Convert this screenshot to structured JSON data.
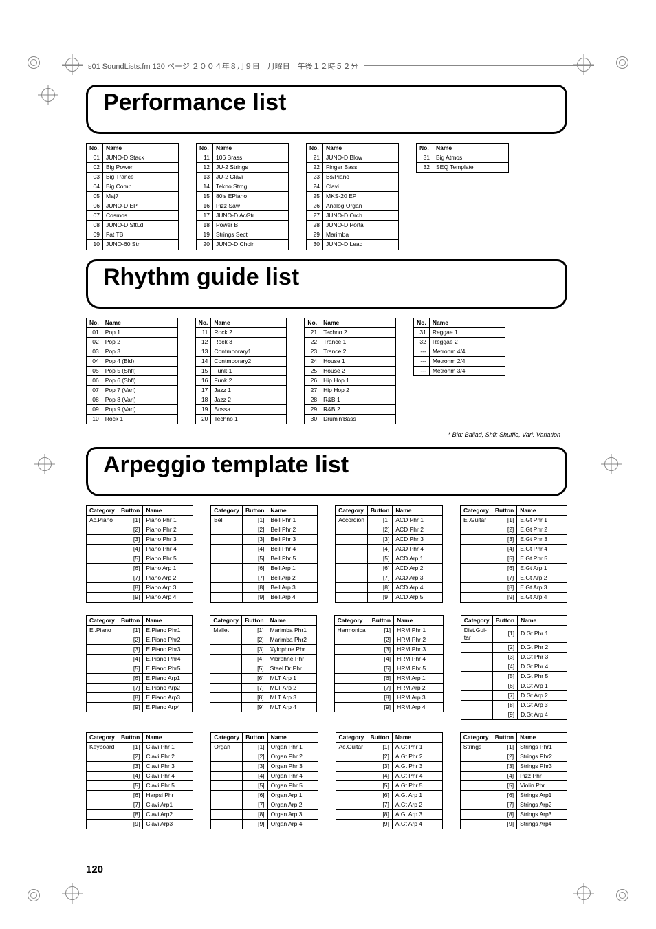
{
  "header_line": "s01 SoundLists.fm  120 ページ  ２００４年８月９日　月曜日　午後１２時５２分",
  "page_number": "120",
  "sections": {
    "performance": {
      "title": "Performance list",
      "columns": [
        [
          [
            "01",
            "JUNO-D Stack"
          ],
          [
            "02",
            "Big Power"
          ],
          [
            "03",
            "Big Trance"
          ],
          [
            "04",
            "Big Comb"
          ],
          [
            "05",
            "Maj7"
          ],
          [
            "06",
            "JUNO-D EP"
          ],
          [
            "07",
            "Cosmos"
          ],
          [
            "08",
            "JUNO-D SftLd"
          ],
          [
            "09",
            "Fat TB"
          ],
          [
            "10",
            "JUNO-60 Str"
          ]
        ],
        [
          [
            "11",
            "106 Brass"
          ],
          [
            "12",
            "JU-2 Strings"
          ],
          [
            "13",
            "JU-2 Clavi"
          ],
          [
            "14",
            "Tekno Strng"
          ],
          [
            "15",
            "80's EPiano"
          ],
          [
            "16",
            "Pizz Saw"
          ],
          [
            "17",
            "JUNO-D AcGtr"
          ],
          [
            "18",
            "Power B"
          ],
          [
            "19",
            "Strings Sect"
          ],
          [
            "20",
            "JUNO-D Choir"
          ]
        ],
        [
          [
            "21",
            "JUNO-D Blow"
          ],
          [
            "22",
            "Finger Bass"
          ],
          [
            "23",
            "Bs/Piano"
          ],
          [
            "24",
            "Clavi"
          ],
          [
            "25",
            "MKS-20 EP"
          ],
          [
            "26",
            "Analog Organ"
          ],
          [
            "27",
            "JUNO-D Orch"
          ],
          [
            "28",
            "JUNO-D Porta"
          ],
          [
            "29",
            "Marimba"
          ],
          [
            "30",
            "JUNO-D Lead"
          ]
        ],
        [
          [
            "31",
            "Big Atmos"
          ],
          [
            "32",
            "SEQ Template"
          ]
        ]
      ]
    },
    "rhythm": {
      "title": "Rhythm guide list",
      "footnote": "*    Bld: Ballad, Shfl: Shuffle, Vari: Variation",
      "columns": [
        [
          [
            "01",
            "Pop 1"
          ],
          [
            "02",
            "Pop 2"
          ],
          [
            "03",
            "Pop 3"
          ],
          [
            "04",
            "Pop 4 (Bld)"
          ],
          [
            "05",
            "Pop 5 (Shfl)"
          ],
          [
            "06",
            "Pop 6 (Shfl)"
          ],
          [
            "07",
            "Pop 7 (Vari)"
          ],
          [
            "08",
            "Pop 8 (Vari)"
          ],
          [
            "09",
            "Pop 9 (Vari)"
          ],
          [
            "10",
            "Rock 1"
          ]
        ],
        [
          [
            "11",
            "Rock 2"
          ],
          [
            "12",
            "Rock 3"
          ],
          [
            "13",
            "Contmporary1"
          ],
          [
            "14",
            "Contmporary2"
          ],
          [
            "15",
            "Funk 1"
          ],
          [
            "16",
            "Funk 2"
          ],
          [
            "17",
            "Jazz 1"
          ],
          [
            "18",
            "Jazz 2"
          ],
          [
            "19",
            "Bossa"
          ],
          [
            "20",
            "Techno 1"
          ]
        ],
        [
          [
            "21",
            "Techno 2"
          ],
          [
            "22",
            "Trance 1"
          ],
          [
            "23",
            "Trance 2"
          ],
          [
            "24",
            "House 1"
          ],
          [
            "25",
            "House 2"
          ],
          [
            "26",
            "Hip Hop 1"
          ],
          [
            "27",
            "Hip Hop 2"
          ],
          [
            "28",
            "R&B 1"
          ],
          [
            "29",
            "R&B 2"
          ],
          [
            "30",
            "Drum'n'Bass"
          ]
        ],
        [
          [
            "31",
            "Reggae 1"
          ],
          [
            "32",
            "Reggae 2"
          ],
          [
            "---",
            "Metronm 4/4"
          ],
          [
            "---",
            "Metronm 2/4"
          ],
          [
            "---",
            "Metronm 3/4"
          ]
        ]
      ]
    },
    "arpeggio": {
      "title": "Arpeggio template list",
      "rows": [
        [
          {
            "cat": "Ac.Piano",
            "items": [
              "Piano Phr 1",
              "Piano Phr 2",
              "Piano Phr 3",
              "Piano Phr 4",
              "Piano Phr 5",
              "Piano Arp 1",
              "Piano Arp 2",
              "Piano Arp 3",
              "Piano Arp 4"
            ]
          },
          {
            "cat": "Bell",
            "items": [
              "Bell Phr 1",
              "Bell Phr 2",
              "Bell Phr 3",
              "Bell Phr 4",
              "Bell Phr 5",
              "Bell Arp 1",
              "Bell Arp 2",
              "Bell Arp 3",
              "Bell Arp 4"
            ]
          },
          {
            "cat": "Accordion",
            "items": [
              "ACD Phr 1",
              "ACD Phr 2",
              "ACD Phr 3",
              "ACD Phr 4",
              "ACD Arp 1",
              "ACD Arp 2",
              "ACD Arp 3",
              "ACD Arp 4",
              "ACD Arp 5"
            ]
          },
          {
            "cat": "El.Guitar",
            "items": [
              "E.Gt Phr 1",
              "E.Gt Phr 2",
              "E.Gt Phr 3",
              "E.Gt Phr 4",
              "E.Gt Phr 5",
              "E.Gt Arp 1",
              "E.Gt Arp 2",
              "E.Gt Arp 3",
              "E.Gt Arp 4"
            ]
          }
        ],
        [
          {
            "cat": "El.Piano",
            "items": [
              "E.Piano Phr1",
              "E.Piano Phr2",
              "E.Piano Phr3",
              "E.Piano Phr4",
              "E.Piano Phr5",
              "E.Piano Arp1",
              "E.Piano Arp2",
              "E.Piano Arp3",
              "E.Piano Arp4"
            ]
          },
          {
            "cat": "Mallet",
            "items": [
              "Marimba Phr1",
              "Marimba Phr2",
              "Xylophne Phr",
              "Vibrphne Phr",
              "Steel Dr Phr",
              "MLT Arp 1",
              "MLT Arp 2",
              "MLT Arp 3",
              "MLT Arp 4"
            ]
          },
          {
            "cat": "Harmonica",
            "items": [
              "HRM Phr 1",
              "HRM Phr 2",
              "HRM Phr 3",
              "HRM Phr 4",
              "HRM Phr 5",
              "HRM Arp 1",
              "HRM Arp 2",
              "HRM Arp 3",
              "HRM Arp 4"
            ]
          },
          {
            "cat": "Dist.Gui-\ntar",
            "items": [
              "D.Gt Phr 1",
              "D.Gt Phr 2",
              "D.Gt Phr 3",
              "D.Gt Phr 4",
              "D.Gt Phr 5",
              "D.Gt Arp 1",
              "D.Gt Arp 2",
              "D.Gt Arp 3",
              "D.Gt Arp 4"
            ]
          }
        ],
        [
          {
            "cat": "Keyboard",
            "items": [
              "Clavi Phr 1",
              "Clavi Phr 2",
              "Clavi Phr 3",
              "Clavi Phr 4",
              "Clavi Phr 5",
              "Harpsi Phr",
              "Clavi Arp1",
              "Clavi Arp2",
              "Clavi Arp3"
            ]
          },
          {
            "cat": "Organ",
            "items": [
              "Organ Phr 1",
              "Organ Phr 2",
              "Organ Phr 3",
              "Organ Phr 4",
              "Organ Phr 5",
              "Organ Arp 1",
              "Organ Arp 2",
              "Organ Arp 3",
              "Organ Arp 4"
            ]
          },
          {
            "cat": "Ac.Guitar",
            "items": [
              "A.Gt Phr 1",
              "A.Gt Phr 2",
              "A.Gt Phr 3",
              "A.Gt Phr 4",
              "A.Gt Phr 5",
              "A.Gt Arp 1",
              "A.Gt Arp 2",
              "A.Gt Arp 3",
              "A.Gt Arp 4"
            ]
          },
          {
            "cat": "Strings",
            "items": [
              "Strings Phr1",
              "Strings Phr2",
              "Strings Phr3",
              "Pizz Phr",
              "Violin Phr",
              "Strings Arp1",
              "Strings Arp2",
              "Strings Arp3",
              "Strings Arp4"
            ]
          }
        ]
      ]
    }
  },
  "labels": {
    "no": "No.",
    "name": "Name",
    "category": "Category",
    "button": "Button"
  }
}
